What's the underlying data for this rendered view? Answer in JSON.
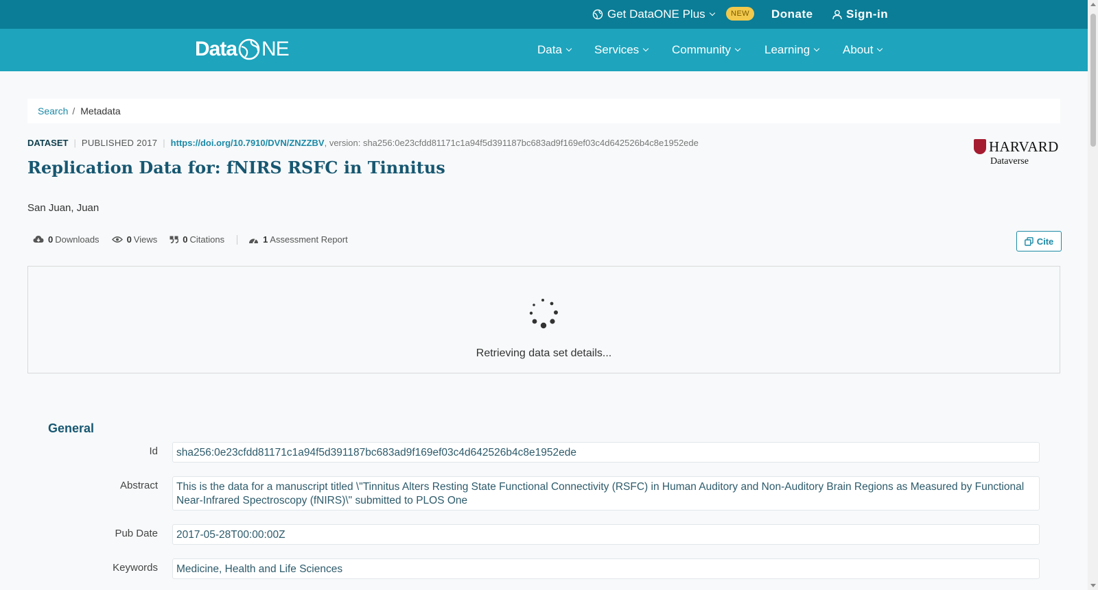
{
  "topbar": {
    "plus_label": "Get DataONE Plus",
    "badge": "NEW",
    "donate": "Donate",
    "signin": "Sign-in"
  },
  "navbar": {
    "logo_text_left": "Data",
    "logo_text_right": "NE",
    "items": [
      {
        "label": "Data"
      },
      {
        "label": "Services"
      },
      {
        "label": "Community"
      },
      {
        "label": "Learning"
      },
      {
        "label": "About"
      }
    ]
  },
  "breadcrumb": {
    "search": "Search",
    "separator": "/",
    "current": "Metadata"
  },
  "dataset": {
    "type": "DATASET",
    "published": "PUBLISHED 2017",
    "doi": "https://doi.org/10.7910/DVN/ZNZZBV",
    "version_text": ", version: sha256:0e23cfdd81171c1a94f5d391187bc683ad9f169ef03c4d642526b4c8e1952ede",
    "title": "Replication Data for: fNIRS RSFC in Tinnitus",
    "author": "San Juan, Juan"
  },
  "repository": {
    "name": "HARVARD",
    "sub": "Dataverse"
  },
  "stats": {
    "downloads_count": "0",
    "downloads_label": "Downloads",
    "views_count": "0",
    "views_label": "Views",
    "citations_count": "0",
    "citations_label": "Citations",
    "assessment_count": "1",
    "assessment_label": "Assessment Report"
  },
  "cite_button": "Cite",
  "loading_text": "Retrieving data set details...",
  "general": {
    "title": "General",
    "rows": [
      {
        "label": "Id",
        "value": "sha256:0e23cfdd81171c1a94f5d391187bc683ad9f169ef03c4d642526b4c8e1952ede"
      },
      {
        "label": "Abstract",
        "value": "This is the data for a manuscript titled \\\"Tinnitus Alters Resting State Functional Connectivity (RSFC) in Human Auditory and Non-Auditory Brain Regions as Measured by Functional Near-Infrared Spectroscopy (fNIRS)\\\" submitted to PLOS One"
      },
      {
        "label": "Pub Date",
        "value": "2017-05-28T00:00:00Z"
      },
      {
        "label": "Keywords",
        "value": "Medicine, Health and Life Sciences"
      }
    ]
  },
  "colors": {
    "topbar": "#0b7d96",
    "navbar": "#1ea4bd",
    "accent": "#1c89a6",
    "title": "#175771",
    "harvard_crimson": "#a51c30"
  }
}
